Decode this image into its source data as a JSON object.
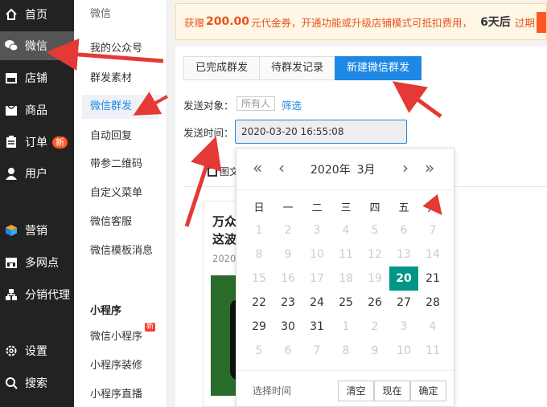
{
  "nav": {
    "items": [
      {
        "label": "首页",
        "icon": "home-icon"
      },
      {
        "label": "微信",
        "icon": "wechat-icon"
      },
      {
        "label": "店铺",
        "icon": "store-icon"
      },
      {
        "label": "商品",
        "icon": "goods-icon"
      },
      {
        "label": "订单",
        "icon": "order-icon",
        "badge": "新"
      },
      {
        "label": "用户",
        "icon": "user-icon"
      },
      {
        "label": "营销",
        "icon": "marketing-icon"
      },
      {
        "label": "多网点",
        "icon": "branches-icon"
      },
      {
        "label": "分销代理",
        "icon": "distribution-icon"
      },
      {
        "label": "设置",
        "icon": "gear-icon"
      },
      {
        "label": "搜索",
        "icon": "search-icon"
      }
    ]
  },
  "submenu": {
    "header": "微信",
    "items": [
      "我的公众号",
      "群发素材",
      "微信群发",
      "自动回复",
      "带参二维码",
      "自定义菜单",
      "微信客服",
      "微信模板消息"
    ],
    "section": "小程序",
    "mini_items": [
      "微信小程序",
      "小程序装修",
      "小程序直播"
    ],
    "new_tag": "新"
  },
  "notice": {
    "prefix": "获赠",
    "amount": "200.00",
    "text": "元代金券，开通功能或升级店铺模式可抵扣费用，",
    "days": "6天后",
    "expire": "过期"
  },
  "tabs": [
    "已完成群发",
    "待群发记录",
    "新建微信群发"
  ],
  "form": {
    "target_label": "发送对象：",
    "target_value": "所有人",
    "filter_link": "筛选",
    "time_label": "发送时间：",
    "time_value": "2020-03-20 16:55:08"
  },
  "content": {
    "tab_label": "图文",
    "card_title": "万众这波",
    "card_date": "2020"
  },
  "datepicker": {
    "year": "2020年",
    "month": "3月",
    "weekdays": [
      "日",
      "一",
      "二",
      "三",
      "四",
      "五",
      "六"
    ],
    "days": [
      [
        "1",
        "2",
        "3",
        "4",
        "5",
        "6",
        "7"
      ],
      [
        "8",
        "9",
        "10",
        "11",
        "12",
        "13",
        "14"
      ],
      [
        "15",
        "16",
        "17",
        "18",
        "19",
        "20",
        "21"
      ],
      [
        "22",
        "23",
        "24",
        "25",
        "26",
        "27",
        "28"
      ],
      [
        "29",
        "30",
        "31",
        "1",
        "2",
        "3",
        "4"
      ],
      [
        "5",
        "6",
        "7",
        "8",
        "9",
        "10",
        "11"
      ]
    ],
    "footer_label": "选择时间",
    "buttons": [
      "清空",
      "现在",
      "确定"
    ]
  },
  "colors": {
    "accent": "#1e88e5",
    "selected_day": "#009688",
    "annotation": "#e53935",
    "nav_bg": "#222222"
  }
}
